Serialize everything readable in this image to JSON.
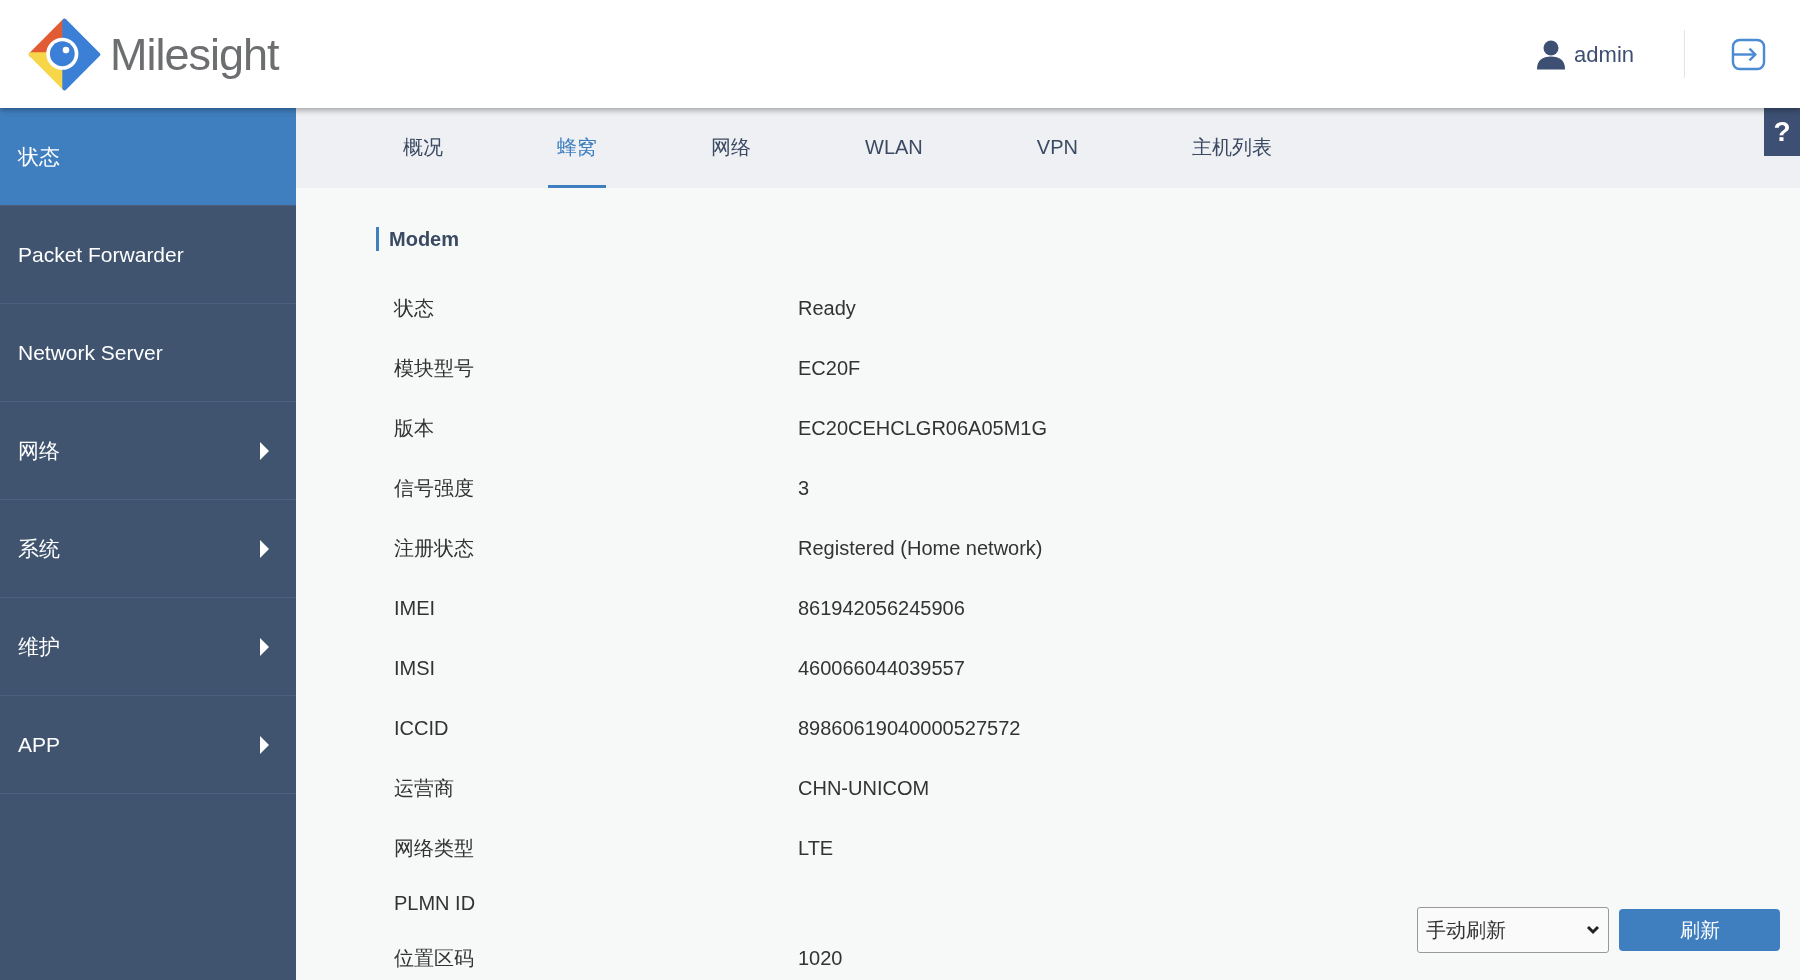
{
  "header": {
    "logo_text": "Milesight",
    "user": "admin"
  },
  "sidebar": {
    "items": [
      {
        "label": "状态",
        "kind": "link",
        "selected": true
      },
      {
        "label": "Packet Forwarder",
        "kind": "link",
        "selected": false
      },
      {
        "label": "Network Server",
        "kind": "link",
        "selected": false
      },
      {
        "label": "网络",
        "kind": "menu",
        "selected": false
      },
      {
        "label": "系统",
        "kind": "menu",
        "selected": false
      },
      {
        "label": "维护",
        "kind": "menu",
        "selected": false
      },
      {
        "label": "APP",
        "kind": "menu",
        "selected": false
      }
    ]
  },
  "tabs": [
    {
      "label": "概况",
      "selected": false
    },
    {
      "label": "蜂窝",
      "selected": true
    },
    {
      "label": "网络",
      "selected": false
    },
    {
      "label": "WLAN",
      "selected": false
    },
    {
      "label": "VPN",
      "selected": false
    },
    {
      "label": "主机列表",
      "selected": false
    }
  ],
  "help": {
    "label": "?"
  },
  "section": {
    "title": "Modem",
    "rows": [
      {
        "label": "状态",
        "value": "Ready"
      },
      {
        "label": "模块型号",
        "value": "EC20F"
      },
      {
        "label": "版本",
        "value": "EC20CEHCLGR06A05M1G"
      },
      {
        "label": "信号强度",
        "value": "3"
      },
      {
        "label": "注册状态",
        "value": "Registered (Home network)"
      },
      {
        "label": "IMEI",
        "value": "861942056245906"
      },
      {
        "label": "IMSI",
        "value": "460066044039557"
      },
      {
        "label": "ICCID",
        "value": "89860619040000527572"
      },
      {
        "label": "运营商",
        "value": "CHN-UNICOM"
      },
      {
        "label": "网络类型",
        "value": "LTE"
      },
      {
        "label": "PLMN ID"
      },
      {
        "label": "位置区码",
        "value": "1020"
      }
    ]
  },
  "refresh": {
    "mode": "手动刷新",
    "button": "刷新"
  }
}
